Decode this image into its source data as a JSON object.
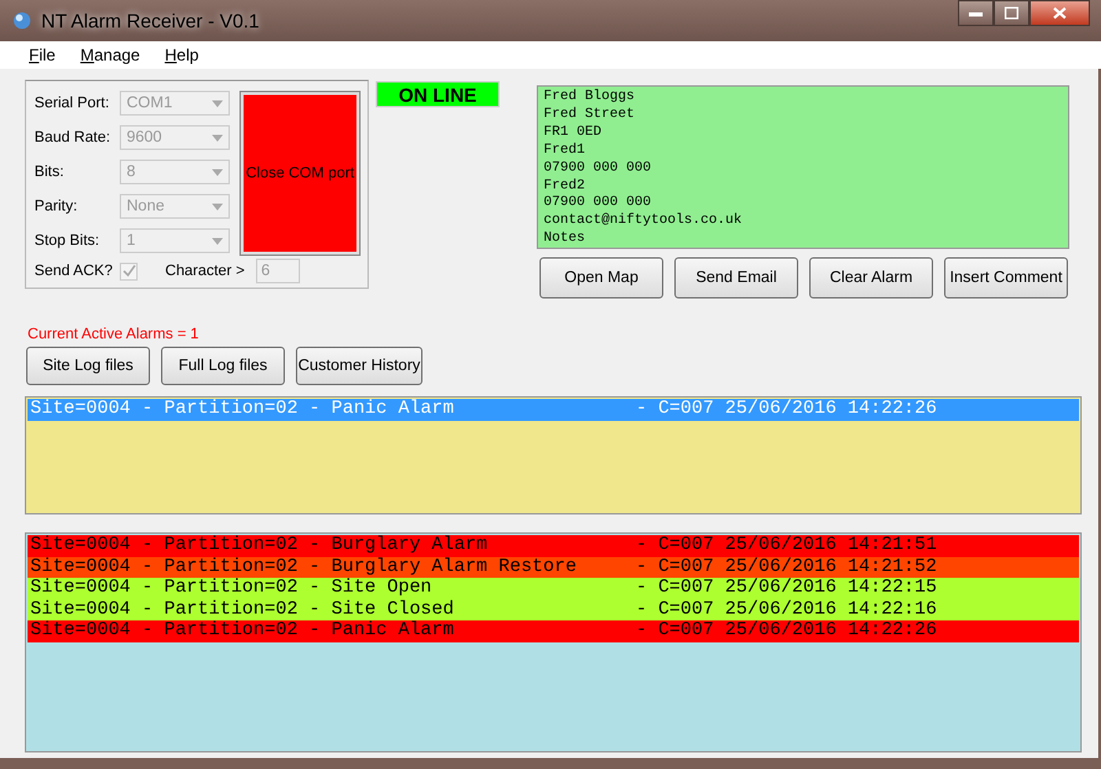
{
  "window": {
    "title": "NT Alarm Receiver - V0.1"
  },
  "menu": [
    {
      "label": "File"
    },
    {
      "label": "Manage"
    },
    {
      "label": "Help"
    }
  ],
  "serial": {
    "fields": [
      {
        "label": "Serial Port:",
        "value": "COM1"
      },
      {
        "label": "Baud Rate:",
        "value": "9600"
      },
      {
        "label": "Bits:",
        "value": "8"
      },
      {
        "label": "Parity:",
        "value": "None"
      },
      {
        "label": "Stop Bits:",
        "value": "1"
      }
    ],
    "send_ack": {
      "label": "Send ACK?",
      "checked": true,
      "disabled": true
    },
    "character": {
      "label": "Character >",
      "value": "6"
    },
    "port_button": "Close COM port"
  },
  "status": "ON LINE",
  "customer_info": [
    "Fred Bloggs",
    "Fred Street",
    "FR1 0ED",
    "Fred1",
    "07900 000 000",
    "Fred2",
    "07900 000 000",
    "contact@niftytools.co.uk",
    "Notes"
  ],
  "action_buttons": [
    "Open Map",
    "Send Email",
    "Clear Alarm",
    "Insert Comment"
  ],
  "active_alarms": "Current Active Alarms = 1",
  "log_buttons": [
    "Site Log files",
    "Full Log files",
    "Customer History"
  ],
  "active_list": [
    {
      "event": "Site=0004 - Partition=02 - Panic Alarm",
      "time": "- C=007 25/06/2016 14:22:26",
      "selected": true
    }
  ],
  "log_list": [
    {
      "event": "Site=0004 - Partition=02 - Burglary Alarm",
      "time": "- C=007 25/06/2016 14:21:51",
      "color": "#ff0000"
    },
    {
      "event": "Site=0004 - Partition=02 - Burglary Alarm Restore",
      "time": "- C=007 25/06/2016 14:21:52",
      "color": "#ff4500"
    },
    {
      "event": "Site=0004 - Partition=02 - Site Open",
      "time": "- C=007 25/06/2016 14:22:15",
      "color": "#adff2f"
    },
    {
      "event": "Site=0004 - Partition=02 - Site Closed",
      "time": "- C=007 25/06/2016 14:22:16",
      "color": "#adff2f"
    },
    {
      "event": "Site=0004 - Partition=02 - Panic Alarm",
      "time": "- C=007 25/06/2016 14:22:26",
      "color": "#ff0000"
    }
  ]
}
